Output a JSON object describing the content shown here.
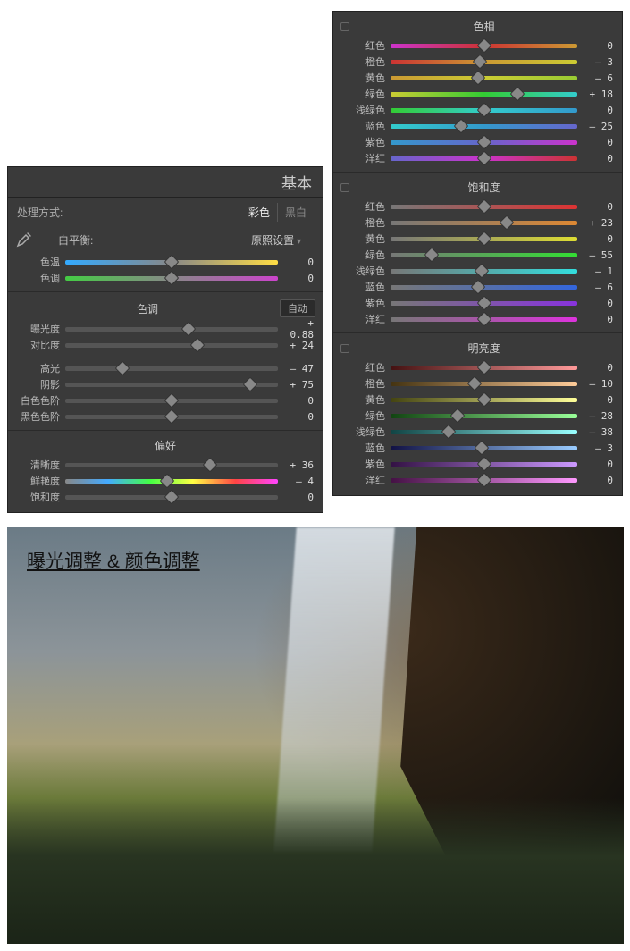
{
  "basic": {
    "title": "基本",
    "mode_label": "处理方式:",
    "mode_color": "彩色",
    "mode_bw": "黑白",
    "wb_label": "白平衡:",
    "wb_preset": "原照设置",
    "wb_sliders": [
      {
        "label": "色温",
        "value": "0",
        "pos": 50,
        "grad": "g-temp"
      },
      {
        "label": "色调",
        "value": "0",
        "pos": 50,
        "grad": "g-tint"
      }
    ],
    "tone_title": "色调",
    "auto_label": "自动",
    "tone_sliders": [
      {
        "label": "曝光度",
        "value": "+ 0.88",
        "pos": 58
      },
      {
        "label": "对比度",
        "value": "+ 24",
        "pos": 62
      }
    ],
    "tone_sliders2": [
      {
        "label": "高光",
        "value": "– 47",
        "pos": 27
      },
      {
        "label": "阴影",
        "value": "+ 75",
        "pos": 87
      },
      {
        "label": "白色色阶",
        "value": "0",
        "pos": 50
      },
      {
        "label": "黑色色阶",
        "value": "0",
        "pos": 50
      }
    ],
    "presence_title": "偏好",
    "presence_sliders": [
      {
        "label": "清晰度",
        "value": "+ 36",
        "pos": 68
      },
      {
        "label": "鲜艳度",
        "value": "– 4",
        "pos": 48,
        "grad": "g-vib"
      },
      {
        "label": "饱和度",
        "value": "0",
        "pos": 50
      }
    ]
  },
  "hsl": {
    "hue_title": "色相",
    "sat_title": "饱和度",
    "lum_title": "明亮度",
    "colors": [
      "红色",
      "橙色",
      "黄色",
      "绿色",
      "浅绿色",
      "蓝色",
      "紫色",
      "洋红"
    ],
    "hue_values": [
      "0",
      "– 3",
      "– 6",
      "+ 18",
      "0",
      "– 25",
      "0",
      "0"
    ],
    "hue_pos": [
      50,
      48,
      47,
      68,
      50,
      38,
      50,
      50
    ],
    "hue_grad": [
      "g-hue-r",
      "g-hue-o",
      "g-hue-y",
      "g-hue-g",
      "g-hue-a",
      "g-hue-b",
      "g-hue-p",
      "g-hue-m"
    ],
    "sat_values": [
      "0",
      "+ 23",
      "0",
      "– 55",
      "– 1",
      "– 6",
      "0",
      "0"
    ],
    "sat_pos": [
      50,
      62,
      50,
      22,
      49,
      47,
      50,
      50
    ],
    "sat_grad": [
      "g-sat-r",
      "g-sat-o",
      "g-sat-y",
      "g-sat-g",
      "g-sat-a",
      "g-sat-b",
      "g-sat-p",
      "g-sat-m"
    ],
    "lum_values": [
      "0",
      "– 10",
      "0",
      "– 28",
      "– 38",
      "– 3",
      "0",
      "0"
    ],
    "lum_pos": [
      50,
      45,
      50,
      36,
      31,
      49,
      50,
      50
    ],
    "lum_grad": [
      "g-lum-r",
      "g-lum-o",
      "g-lum-y",
      "g-lum-g",
      "g-lum-a",
      "g-lum-b",
      "g-lum-p",
      "g-lum-m"
    ]
  },
  "preview": {
    "caption": "曝光调整 & 颜色调整"
  }
}
